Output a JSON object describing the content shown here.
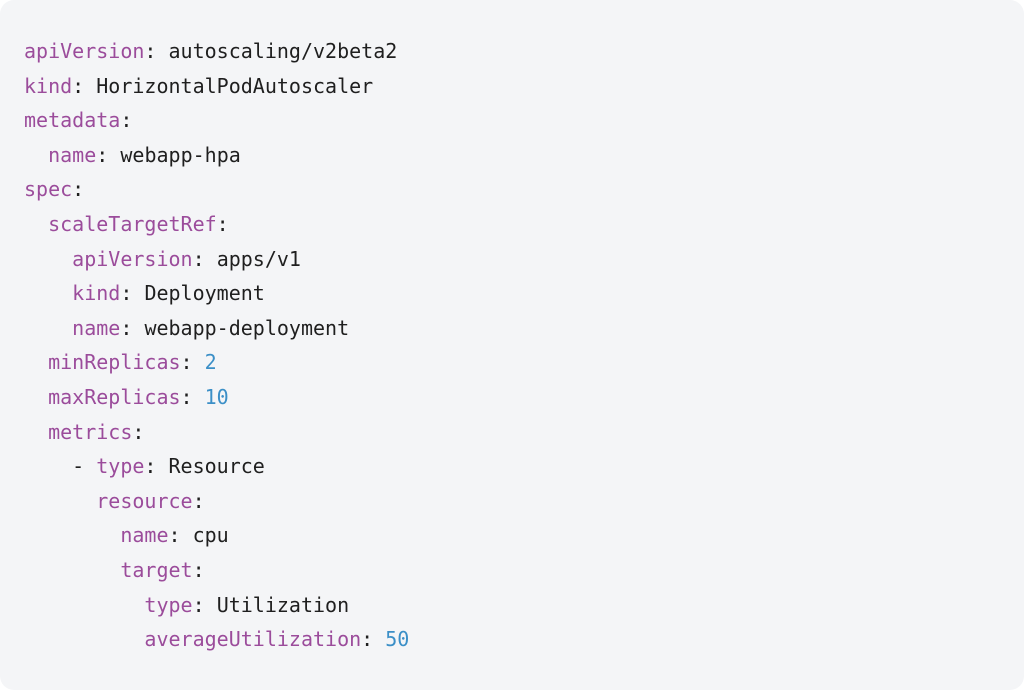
{
  "colors": {
    "background": "#f4f5f7",
    "key": "#9b4c9b",
    "string_value": "#1f1f1f",
    "number_value": "#3b8fc7"
  },
  "code": {
    "lines": [
      {
        "indent": 0,
        "key": "apiVersion",
        "sep": ": ",
        "value": "autoscaling/v2beta2",
        "vtype": "str"
      },
      {
        "indent": 0,
        "key": "kind",
        "sep": ": ",
        "value": "HorizontalPodAutoscaler",
        "vtype": "str"
      },
      {
        "indent": 0,
        "key": "metadata",
        "sep": ":",
        "value": "",
        "vtype": "none"
      },
      {
        "indent": 1,
        "key": "name",
        "sep": ": ",
        "value": "webapp-hpa",
        "vtype": "str"
      },
      {
        "indent": 0,
        "key": "spec",
        "sep": ":",
        "value": "",
        "vtype": "none"
      },
      {
        "indent": 1,
        "key": "scaleTargetRef",
        "sep": ":",
        "value": "",
        "vtype": "none"
      },
      {
        "indent": 2,
        "key": "apiVersion",
        "sep": ": ",
        "value": "apps/v1",
        "vtype": "str"
      },
      {
        "indent": 2,
        "key": "kind",
        "sep": ": ",
        "value": "Deployment",
        "vtype": "str"
      },
      {
        "indent": 2,
        "key": "name",
        "sep": ": ",
        "value": "webapp-deployment",
        "vtype": "str"
      },
      {
        "indent": 1,
        "key": "minReplicas",
        "sep": ": ",
        "value": "2",
        "vtype": "num"
      },
      {
        "indent": 1,
        "key": "maxReplicas",
        "sep": ": ",
        "value": "10",
        "vtype": "num"
      },
      {
        "indent": 1,
        "key": "metrics",
        "sep": ":",
        "value": "",
        "vtype": "none"
      },
      {
        "indent": 2,
        "prefix": "- ",
        "key": "type",
        "sep": ": ",
        "value": "Resource",
        "vtype": "str"
      },
      {
        "indent": 3,
        "key": "resource",
        "sep": ":",
        "value": "",
        "vtype": "none"
      },
      {
        "indent": 4,
        "key": "name",
        "sep": ": ",
        "value": "cpu",
        "vtype": "str"
      },
      {
        "indent": 4,
        "key": "target",
        "sep": ":",
        "value": "",
        "vtype": "none"
      },
      {
        "indent": 5,
        "key": "type",
        "sep": ": ",
        "value": "Utilization",
        "vtype": "str"
      },
      {
        "indent": 5,
        "key": "averageUtilization",
        "sep": ": ",
        "value": "50",
        "vtype": "num"
      }
    ]
  }
}
